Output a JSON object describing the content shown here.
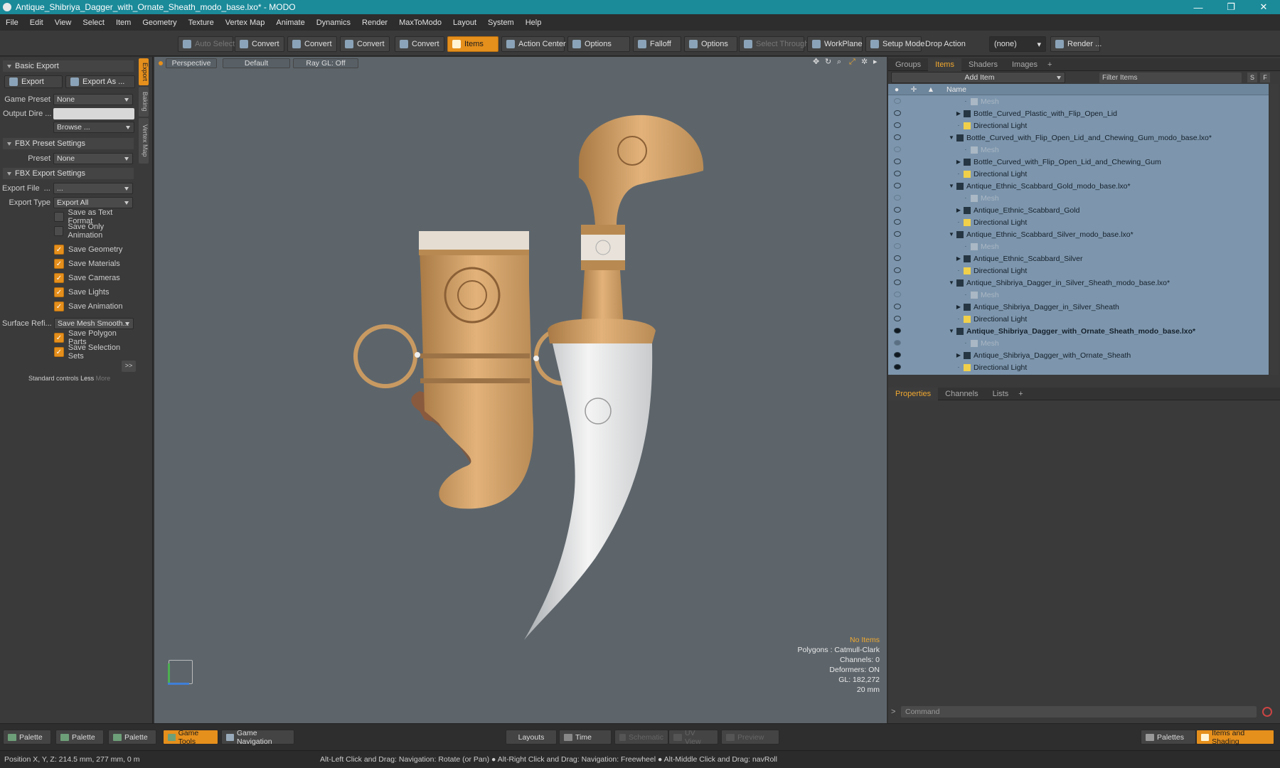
{
  "window": {
    "title": "Antique_Shibriya_Dagger_with_Ornate_Sheath_modo_base.lxo* - MODO",
    "minimize": "—",
    "maximize": "❐",
    "close": "✕"
  },
  "menu": [
    "File",
    "Edit",
    "View",
    "Select",
    "Item",
    "Geometry",
    "Texture",
    "Vertex Map",
    "Animate",
    "Dynamics",
    "Render",
    "MaxToModo",
    "Layout",
    "System",
    "Help"
  ],
  "toolbar": {
    "auto_select": "Auto Select",
    "convert1": "Convert",
    "convert2": "Convert",
    "convert3": "Convert",
    "convert4": "Convert",
    "items": "Items",
    "action_center": "Action Center",
    "options1": "Options",
    "falloff": "Falloff",
    "options2": "Options",
    "select_through": "Select Through",
    "workplane": "WorkPlane",
    "setup_mode": "Setup Mode",
    "drop_action": "Drop Action",
    "drop_value": "(none)",
    "render": "Render ..."
  },
  "left": {
    "basic_export": "Basic Export",
    "export": "Export",
    "export_as": "Export As ...",
    "game_preset_label": "Game Preset",
    "game_preset": "None",
    "output_dir_label": "Output Dire ...",
    "browse": "Browse ...",
    "fbx_preset": "FBX Preset Settings",
    "preset_label": "Preset",
    "preset": "None",
    "fbx_export": "FBX Export Settings",
    "export_file_label": "Export File",
    "export_file": "...",
    "export_type_label": "Export Type",
    "export_type": "Export All",
    "checks": [
      {
        "label": "Save as Text Format",
        "on": false
      },
      {
        "label": "Save Only Animation",
        "on": false
      },
      {
        "label": "Save Geometry",
        "on": true
      },
      {
        "label": "Save Materials",
        "on": true
      },
      {
        "label": "Save Cameras",
        "on": true
      },
      {
        "label": "Save Lights",
        "on": true
      },
      {
        "label": "Save Animation",
        "on": true
      }
    ],
    "surface_label": "Surface Refi...",
    "surface": "Save Mesh Smooth...",
    "checks2": [
      {
        "label": "Save Polygon Parts",
        "on": true
      },
      {
        "label": "Save Selection Sets",
        "on": true
      }
    ],
    "more_btn": ">>",
    "standard": "Standard controls",
    "less": "Less",
    "more": "More",
    "vtabs": [
      "Export",
      "Baking",
      "Vertex Map"
    ]
  },
  "viewport": {
    "perspective": "Perspective",
    "default": "Default",
    "raygl": "Ray GL: Off",
    "no_items": "No Items",
    "polygons": "Polygons : Catmull-Clark",
    "channels": "Channels: 0",
    "deformers": "Deformers: ON",
    "gl": "GL: 182,272",
    "scale": "20 mm"
  },
  "right": {
    "tabs": [
      "Groups",
      "Items",
      "Shaders",
      "Images"
    ],
    "add_item": "Add Item",
    "filter": "Filter Items",
    "s": "S",
    "f": "F",
    "name_col": "Name",
    "items": [
      {
        "t": "Mesh",
        "k": "mesh",
        "lvl": 2
      },
      {
        "t": "Bottle_Curved_Plastic_with_Flip_Open_Lid",
        "k": "loc",
        "lvl": 1
      },
      {
        "t": "Directional Light",
        "k": "light",
        "lvl": 1
      },
      {
        "t": "Bottle_Curved_with_Flip_Open_Lid_and_Chewing_Gum_modo_base.lxo*",
        "k": "scene",
        "lvl": 0
      },
      {
        "t": "Mesh",
        "k": "mesh",
        "lvl": 2
      },
      {
        "t": "Bottle_Curved_with_Flip_Open_Lid_and_Chewing_Gum",
        "k": "loc",
        "lvl": 1
      },
      {
        "t": "Directional Light",
        "k": "light",
        "lvl": 1
      },
      {
        "t": "Antique_Ethnic_Scabbard_Gold_modo_base.lxo*",
        "k": "scene",
        "lvl": 0
      },
      {
        "t": "Mesh",
        "k": "mesh",
        "lvl": 2
      },
      {
        "t": "Antique_Ethnic_Scabbard_Gold",
        "k": "loc",
        "lvl": 1
      },
      {
        "t": "Directional Light",
        "k": "light",
        "lvl": 1
      },
      {
        "t": "Antique_Ethnic_Scabbard_Silver_modo_base.lxo*",
        "k": "scene",
        "lvl": 0
      },
      {
        "t": "Mesh",
        "k": "mesh",
        "lvl": 2
      },
      {
        "t": "Antique_Ethnic_Scabbard_Silver",
        "k": "loc",
        "lvl": 1
      },
      {
        "t": "Directional Light",
        "k": "light",
        "lvl": 1
      },
      {
        "t": "Antique_Shibriya_Dagger_in_Silver_Sheath_modo_base.lxo*",
        "k": "scene",
        "lvl": 0
      },
      {
        "t": "Mesh",
        "k": "mesh",
        "lvl": 2
      },
      {
        "t": "Antique_Shibriya_Dagger_in_Silver_Sheath",
        "k": "loc",
        "lvl": 1
      },
      {
        "t": "Directional Light",
        "k": "light",
        "lvl": 1
      },
      {
        "t": "Antique_Shibriya_Dagger_with_Ornate_Sheath_modo_base.lxo*",
        "k": "scene",
        "lvl": 0,
        "bold": true
      },
      {
        "t": "Mesh",
        "k": "mesh",
        "lvl": 2
      },
      {
        "t": "Antique_Shibriya_Dagger_with_Ornate_Sheath",
        "k": "loc",
        "lvl": 1
      },
      {
        "t": "Directional Light",
        "k": "light",
        "lvl": 1
      }
    ],
    "prop_tabs": [
      "Properties",
      "Channels",
      "Lists"
    ],
    "command": "Command"
  },
  "bottom": {
    "palette1": "Palette",
    "palette2": "Palette",
    "palette3": "Palette",
    "game_tools": "Game Tools",
    "game_nav": "Game Navigation",
    "layouts": "Layouts",
    "time": "Time",
    "schematic": "Schematic",
    "uv_view": "UV View",
    "preview": "Preview",
    "palettes": "Palettes",
    "items_shading": "Items and Shading"
  },
  "status": {
    "position": "Position X, Y, Z:  214.5 mm, 277 mm, 0 m",
    "hint": "Alt-Left Click and Drag: Navigation: Rotate (or Pan) ● Alt-Right Click and Drag: Navigation: Freewheel ● Alt-Middle Click and Drag: navRoll"
  },
  "colors": {
    "accent": "#e58f1c",
    "title": "#1b8a99",
    "list": "#7d96ad"
  }
}
